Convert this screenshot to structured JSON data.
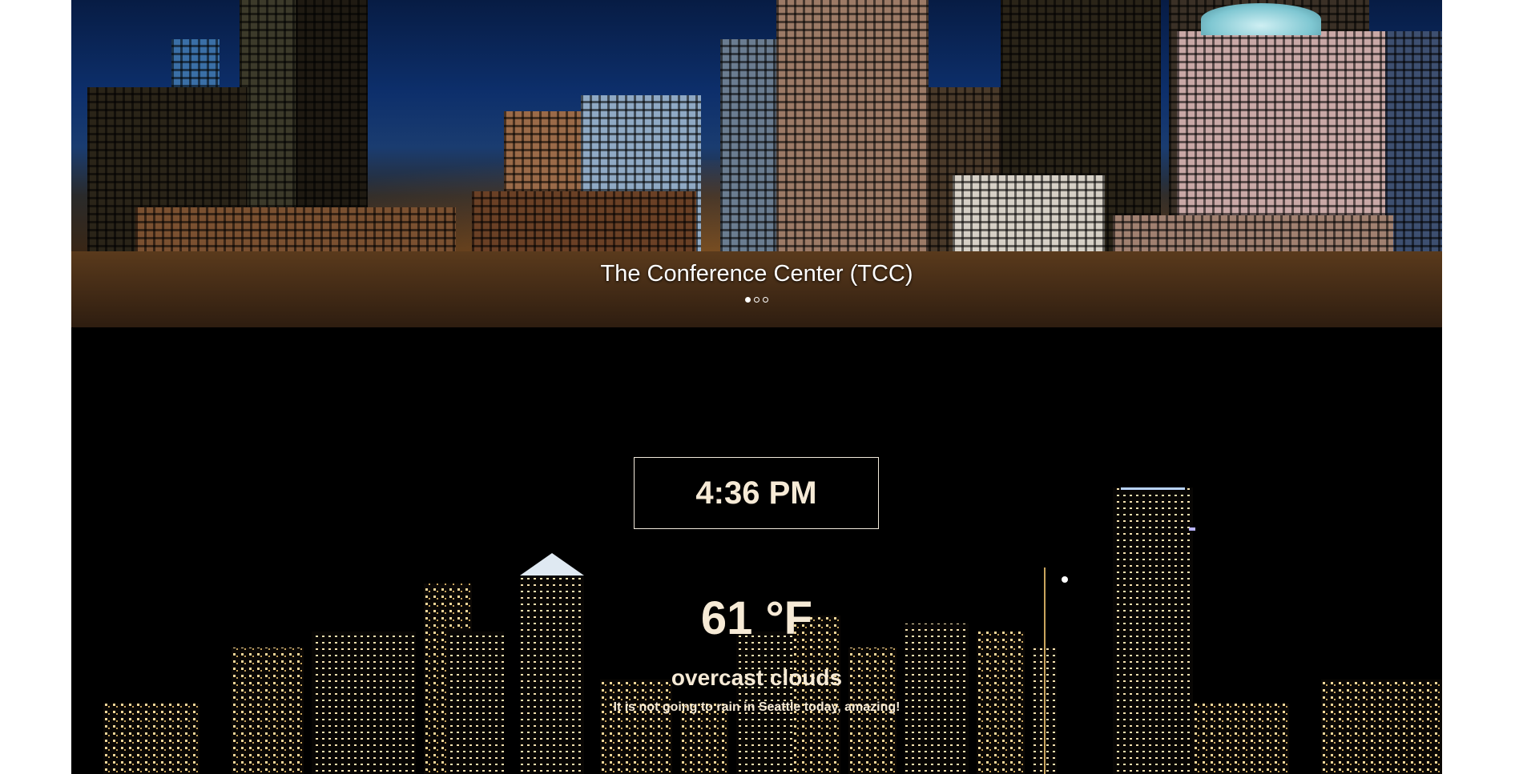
{
  "carousel": {
    "caption": "The Conference Center (TCC)",
    "slide_count": 3,
    "active_slide": 1
  },
  "weather": {
    "time": "4:36 PM",
    "temperature": "61 °F",
    "conditions": "overcast clouds",
    "remark": "It is not going to rain in Seattle today, amazing!"
  },
  "colors": {
    "text": "#f6ead6",
    "background": "#000000",
    "page": "#ffffff"
  }
}
